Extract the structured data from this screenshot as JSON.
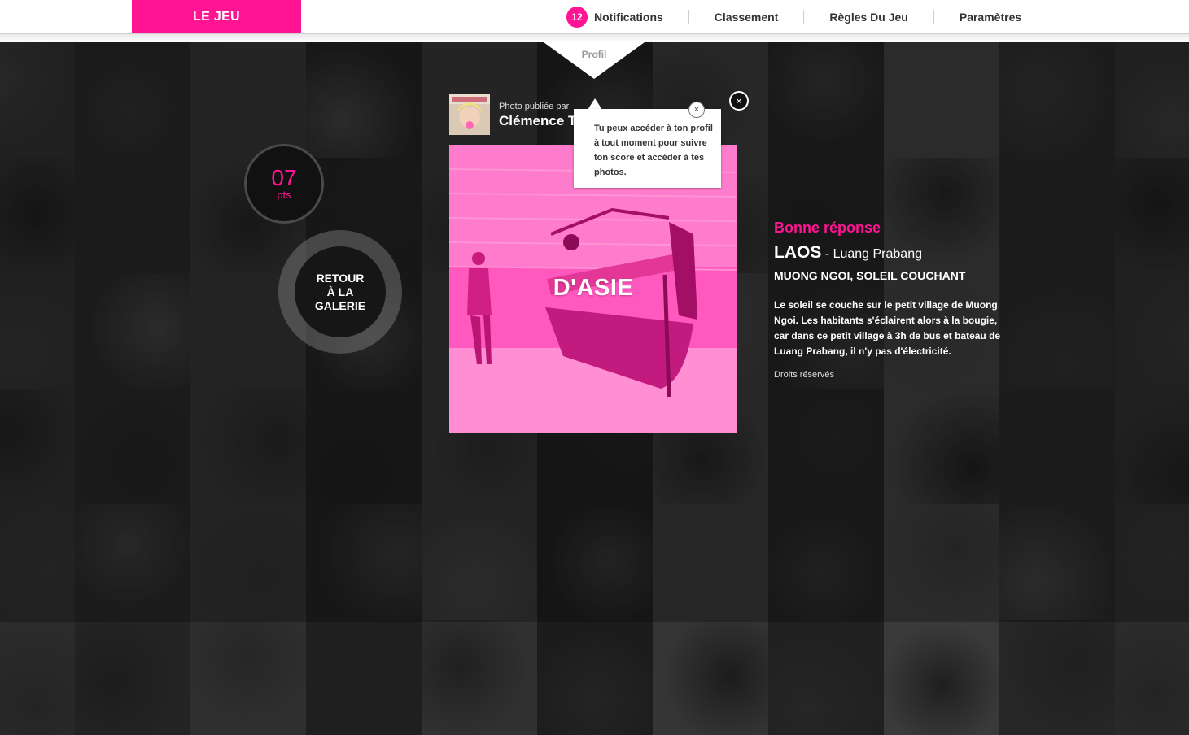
{
  "header": {
    "logo_label": "LE JEU",
    "notifications_count": "12",
    "nav": {
      "notifications": "Notifications",
      "classement": "Classement",
      "regles": "Règles Du Jeu",
      "parametres": "Paramètres"
    },
    "profil_tab": "Profil"
  },
  "score": {
    "value": "07",
    "unit": "pts"
  },
  "back_button": {
    "label_line1": "RETOUR",
    "label_line2": "À LA",
    "label_line3": "GALERIE"
  },
  "card": {
    "published_by": "Photo publiée par",
    "author": "Clémence T",
    "photo_title": "D'ASIE",
    "close_symbol": "×"
  },
  "tooltip": {
    "text": "Tu peux accéder à ton profil à tout moment pour suivre ton score et accéder à tes photos.",
    "close_symbol": "×"
  },
  "answer": {
    "verdict": "Bonne réponse",
    "country": "LAOS",
    "city": " - Luang Prabang",
    "place": "MUONG NGOI, SOLEIL COUCHANT",
    "description": "Le soleil se couche sur le petit village de Muong Ngoi. Les habitants s'éclairent alors à la bougie, car dans ce petit village à 3h de bus et bateau de Luang Prabang, il n'y pas d'électricité.",
    "rights": "Droits réservés"
  },
  "colors": {
    "accent": "#ff1493",
    "background": "#1a1a1a",
    "bar": "#ffffff"
  }
}
